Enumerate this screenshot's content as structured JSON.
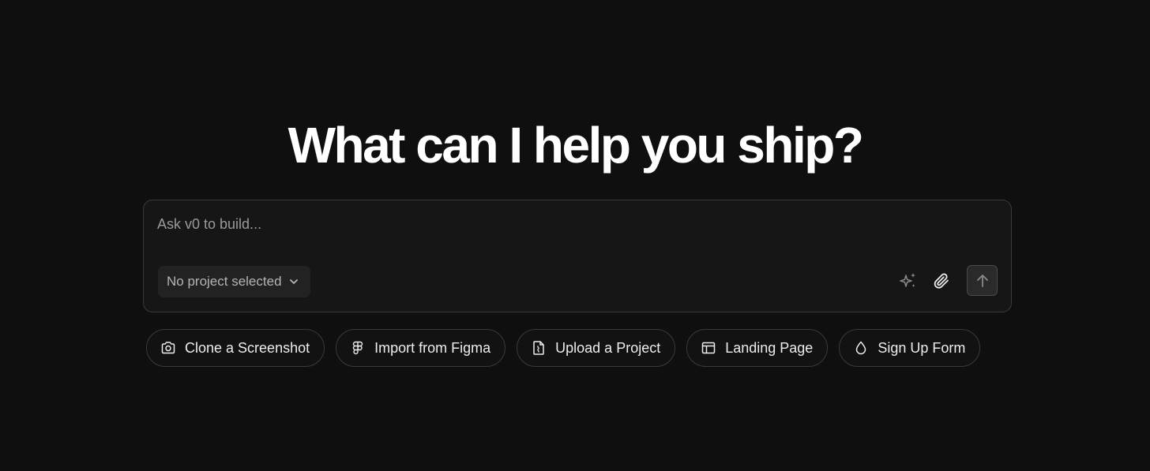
{
  "headline": "What can I help you ship?",
  "composer": {
    "placeholder": "Ask v0 to build...",
    "project_select": {
      "label": "No project selected",
      "icon": "chevron-down-icon"
    },
    "actions": [
      {
        "name": "enhance-prompt-button",
        "icon": "sparkles-icon"
      },
      {
        "name": "attach-button",
        "icon": "paperclip-icon"
      },
      {
        "name": "send-button",
        "icon": "arrow-up-icon"
      }
    ]
  },
  "suggestions": [
    {
      "label": "Clone a Screenshot",
      "icon": "camera-icon"
    },
    {
      "label": "Import from Figma",
      "icon": "figma-icon"
    },
    {
      "label": "Upload a Project",
      "icon": "file-upload-icon"
    },
    {
      "label": "Landing Page",
      "icon": "layout-icon"
    },
    {
      "label": "Sign Up Form",
      "icon": "droplet-icon"
    }
  ],
  "colors": {
    "background": "#0f0f0f",
    "composer_bg": "#161616",
    "border": "#3a3a3a",
    "text": "#ededed",
    "muted": "#9a9a9a"
  }
}
